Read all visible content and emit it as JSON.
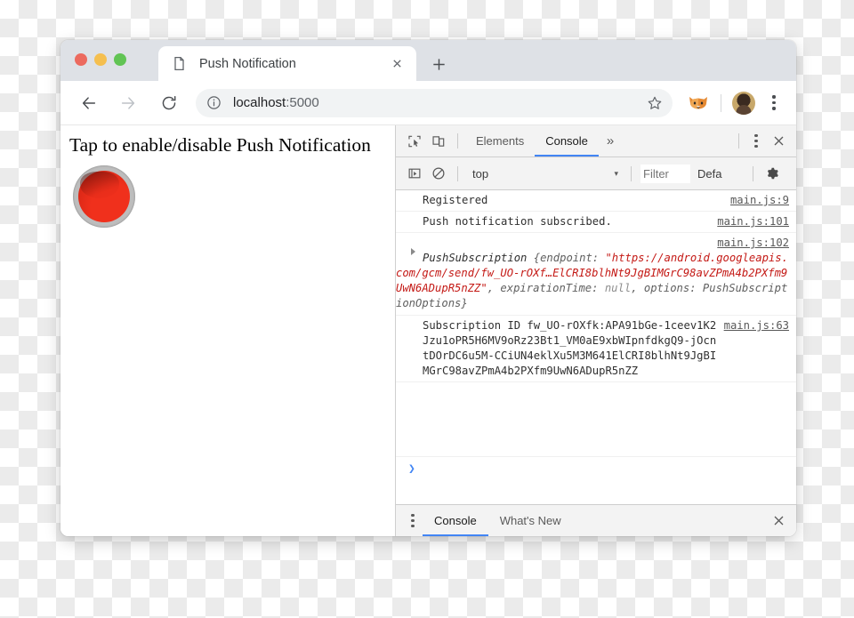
{
  "window": {
    "traffic_lights": [
      "close",
      "minimize",
      "zoom"
    ]
  },
  "tabstrip": {
    "tab_title": "Push Notification",
    "tab_favicon": "page-icon",
    "close_label": "✕",
    "newtab_label": "+"
  },
  "toolbar": {
    "back_label": "←",
    "forward_label": "→",
    "reload_label": "⟳",
    "security_icon": "info-circle-icon",
    "url_host": "localhost",
    "url_port": ":5000",
    "bookmark_icon": "star-icon",
    "extension_icon": "fox-extension-icon",
    "avatar_icon": "profile-avatar",
    "menu_icon": "three-dot-menu-icon"
  },
  "page": {
    "heading": "Tap to enable/disable Push Notification",
    "button_name": "push-toggle-button",
    "button_color": "#e02a18",
    "ring_color": "#bdbdbd"
  },
  "devtools": {
    "main_tabs": [
      {
        "label": "Elements",
        "active": false
      },
      {
        "label": "Console",
        "active": true
      }
    ],
    "more_tabs_label": "»",
    "inspect_icon": "inspect-element-icon",
    "device_icon": "device-toolbar-icon",
    "kebab_icon": "more-options-icon",
    "close_icon": "close-devtools-icon",
    "filterbar": {
      "execute_icon": "console-sidebar-icon",
      "clear_icon": "clear-console-icon",
      "context_value": "top",
      "context_arrow": "▾",
      "filter_placeholder": "Filter",
      "filter_value": "",
      "levels_label": "Defa",
      "settings_icon": "settings-gear-icon"
    },
    "messages": [
      {
        "kind": "simple",
        "text": "Registered",
        "source": "main.js:9"
      },
      {
        "kind": "simple",
        "text": "Push notification subscribed.",
        "source": "main.js:101"
      },
      {
        "kind": "object",
        "source": "main.js:102",
        "name": "PushSubscription ",
        "open_brace": "{",
        "prop_endpoint": "endpoint: ",
        "endpoint_value": "\"https://android.googleapis.com/gcm/send/fw_UO-rOXf…ElCRI8blhNt9JgBIMGrC98avZPmA4b2PXfm9UwN6ADupR5nZZ\"",
        "comma_1": ", ",
        "prop_expiration": "expirationTime: ",
        "expiration_value": "null",
        "comma_2": ", ",
        "prop_options": "options: PushSubscriptionOptions",
        "close_brace": "}"
      },
      {
        "kind": "simple",
        "text": "Subscription ID fw_UO-rOXfk:APA91bGe-1ceev1K2Jzu1oPR5H6MV9oRz23Bt1_VM0aE9xbWIpnfdkgQ9-jOcntDOrDC6u5M-CCiUN4eklXu5M3M641ElCRI8blhNt9JgBIMGrC98avZPmA4b2PXfm9UwN6ADupR5nZZ",
        "source": "main.js:63"
      }
    ],
    "prompt_caret": "❯",
    "drawer_tabs": [
      {
        "label": "Console",
        "active": true
      },
      {
        "label": "What's New",
        "active": false
      }
    ],
    "drawer_kebab_icon": "drawer-more-options-icon",
    "drawer_close_icon": "close-drawer-icon"
  }
}
